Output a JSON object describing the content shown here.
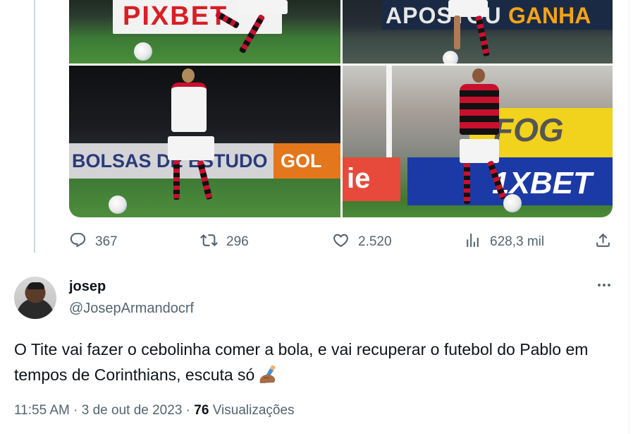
{
  "banners": {
    "top_left": "PIXBET",
    "top_right_a": "APOSTOU",
    "top_right_b": "GANHA",
    "bottom_left": "BOLSAS DE ESTUDO",
    "bottom_left_sponsor": "GOL",
    "bottom_right_main": "1XBET",
    "bottom_right_yellow": "FOG",
    "bottom_right_red": "ie"
  },
  "actions": {
    "replies": {
      "icon": "reply-icon",
      "count": "367"
    },
    "reposts": {
      "icon": "repost-icon",
      "count": "296"
    },
    "likes": {
      "icon": "heart-icon",
      "count": "2.520"
    },
    "views": {
      "icon": "views-chart-icon",
      "count": "628,3 mil"
    },
    "share": {
      "icon": "share-icon"
    }
  },
  "reply": {
    "display_name": "josep",
    "handle": "@JosepArmandocrf",
    "text": "O Tite vai fazer o cebolinha comer a bola, e vai recuperar o futebol do Pablo em tempos de Corinthians, escuta só",
    "emoji": "writing-hand-emoji",
    "meta_time": "11:55 AM · 3 de out de 2023 · ",
    "meta_views_count": "76",
    "meta_views_label": " Visualizações"
  },
  "colors": {
    "text_primary": "#0f1419",
    "text_secondary": "#536471",
    "thread_line": "#cfd9de",
    "flamengo_red": "#c8102e"
  }
}
